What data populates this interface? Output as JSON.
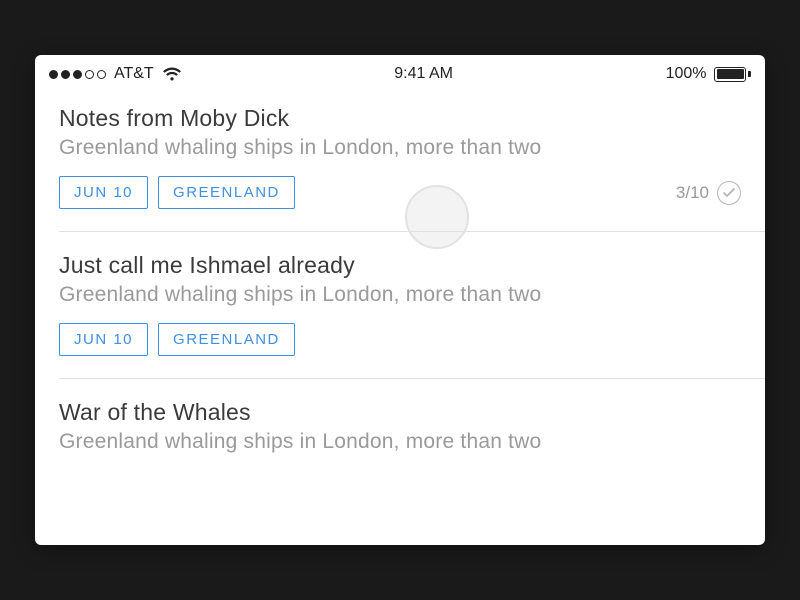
{
  "statusbar": {
    "carrier": "AT&T",
    "time": "9:41 AM",
    "battery_pct": "100%"
  },
  "notes": [
    {
      "title": "Notes from Moby Dick",
      "preview": "Greenland whaling ships in London, more than two",
      "tags": [
        "JUN 10",
        "GREENLAND"
      ],
      "progress": "3/10",
      "show_progress": true
    },
    {
      "title": "Just call me Ishmael already",
      "preview": "Greenland whaling ships in London, more than two",
      "tags": [
        "JUN 10",
        "GREENLAND"
      ],
      "progress": null,
      "show_progress": false
    },
    {
      "title": "War of the Whales",
      "preview": "Greenland whaling ships in London, more than two",
      "tags": [],
      "progress": null,
      "show_progress": false
    }
  ]
}
